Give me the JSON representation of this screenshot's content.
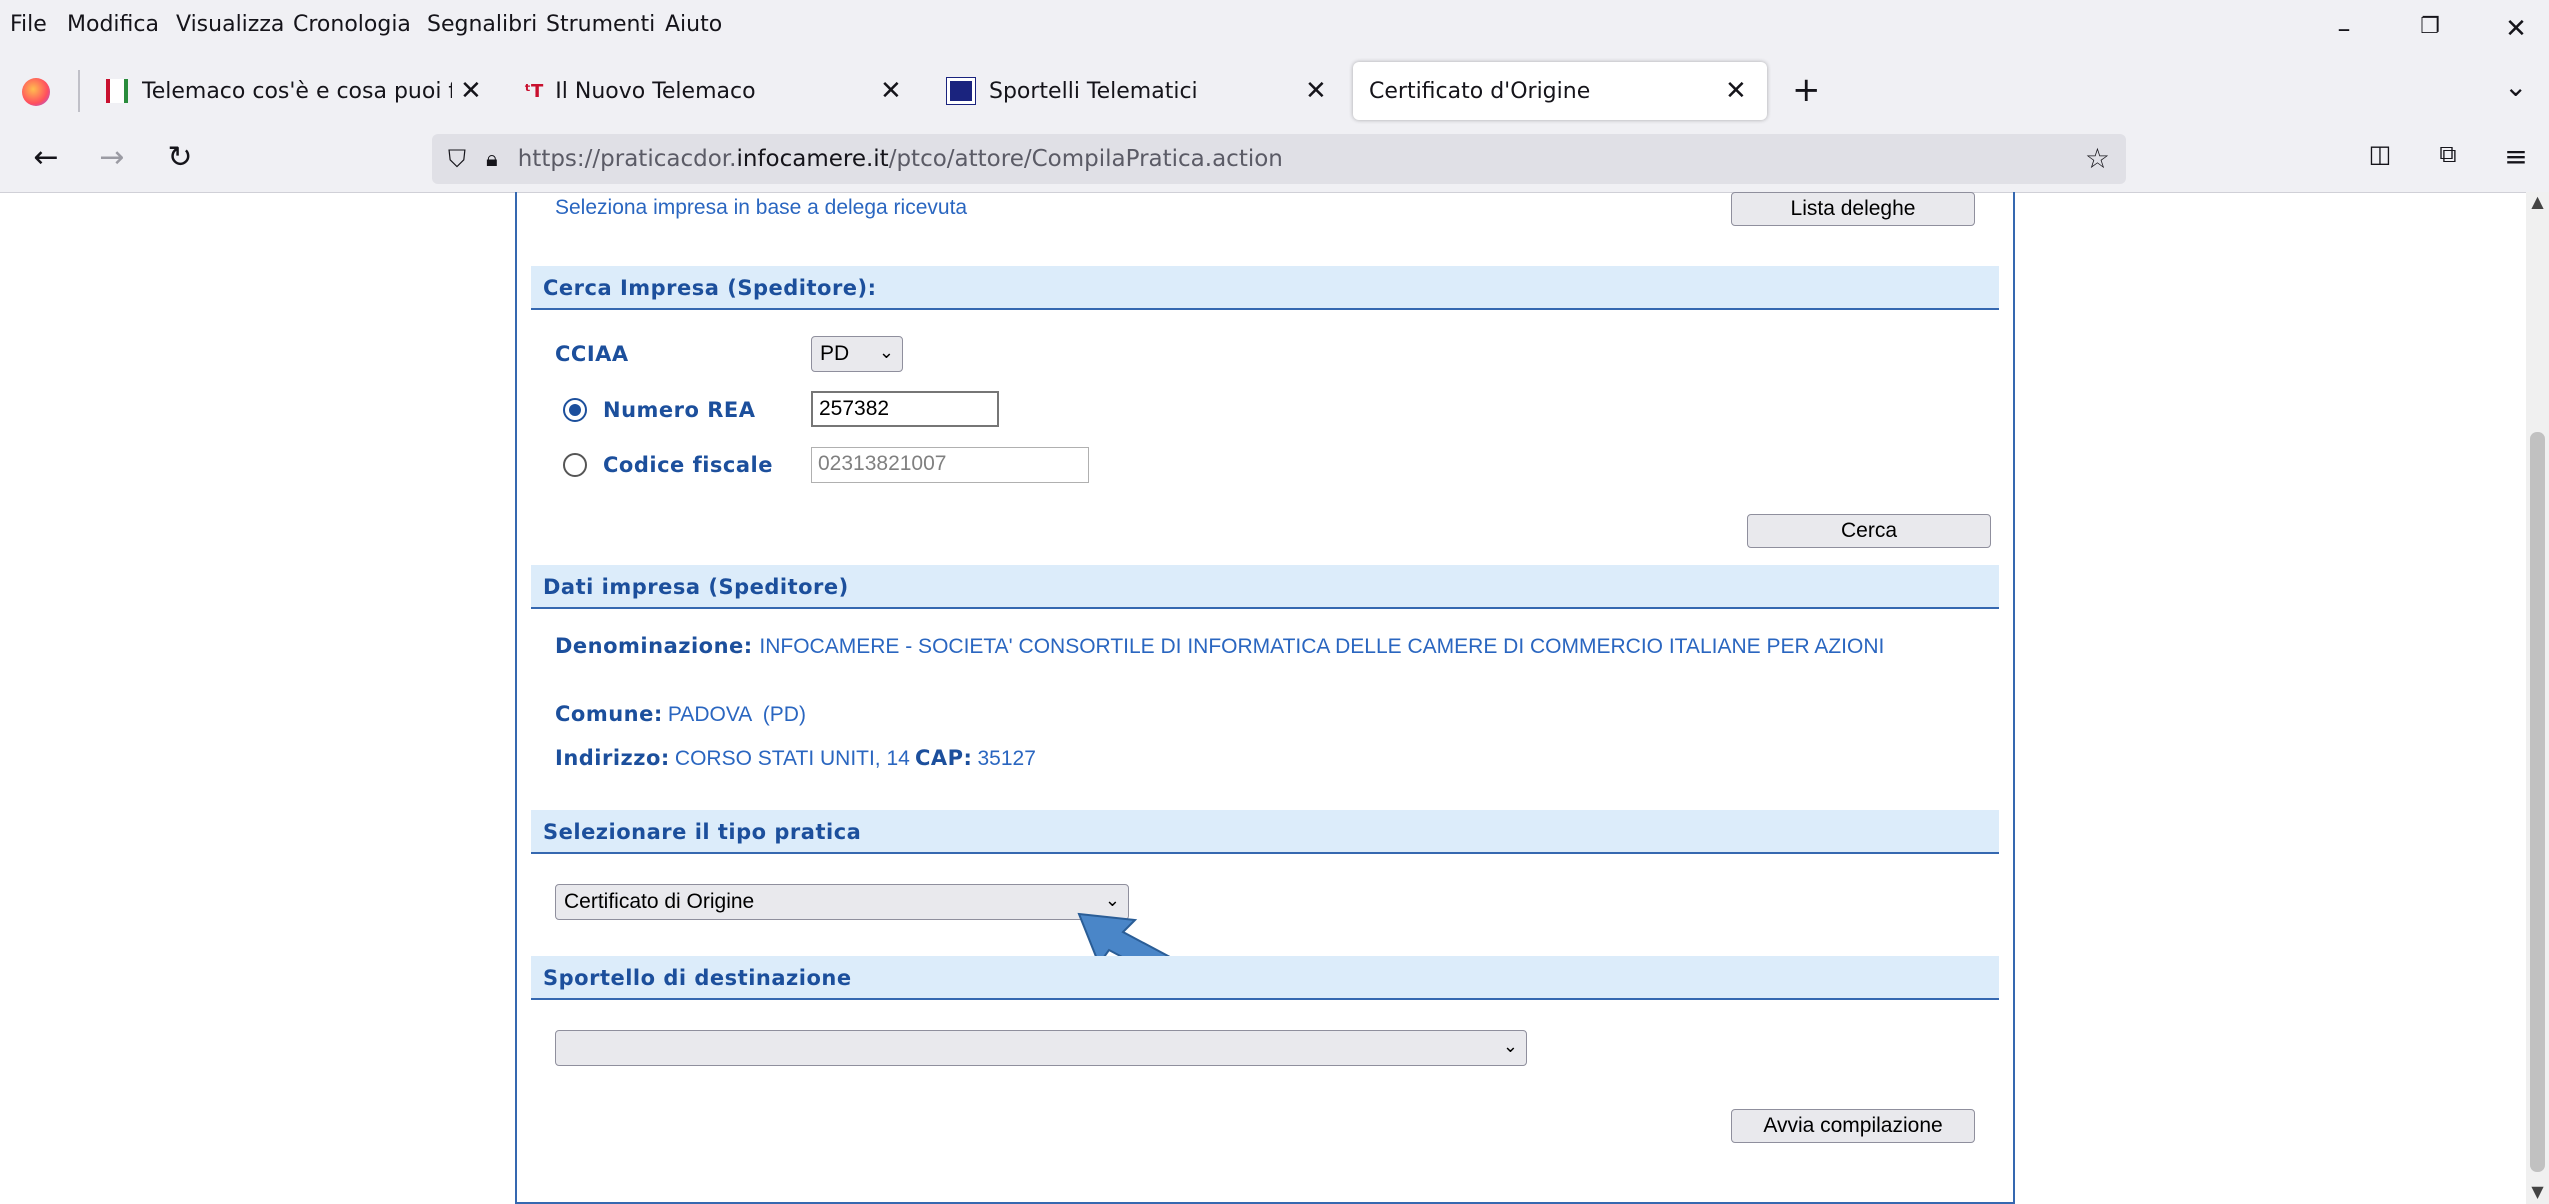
{
  "menubar": {
    "items": [
      "File",
      "Modifica",
      "Visualizza",
      "Cronologia",
      "Segnalibri",
      "Strumenti",
      "Aiuto"
    ],
    "window_controls": {
      "minimize": "–",
      "restore": "❐",
      "close": "✕"
    }
  },
  "tabs": [
    {
      "label": "Telemaco cos'è e cosa puoi fare",
      "icon": "telemaco-icon",
      "active": false
    },
    {
      "label": "Il Nuovo Telemaco",
      "icon": "telemaco-new-icon",
      "active": false
    },
    {
      "label": "Sportelli Telematici",
      "icon": "sportelli-icon",
      "active": false
    },
    {
      "label": "Certificato d'Origine",
      "icon": "",
      "active": true
    }
  ],
  "tab_close": "✕",
  "new_tab": "+",
  "navbar": {
    "url_prefix": "https://praticacdor.",
    "url_host": "infocamere.it",
    "url_path": "/ptco/attore/CompilaPratica.action"
  },
  "form": {
    "delega_text": "Seleziona impresa in base a delega ricevuta",
    "delega_button": "Lista deleghe",
    "cerca_section": "Cerca Impresa (Speditore):",
    "cciaa_label": "CCIAA",
    "cciaa_value": "PD",
    "rea_label": "Numero REA",
    "rea_value": "257382",
    "cf_label": "Codice fiscale",
    "cf_value": "02313821007",
    "cerca_button": "Cerca",
    "dati_section": "Dati impresa (Speditore)",
    "denominazione_label": "Denominazione:",
    "denominazione_value": "INFOCAMERE - SOCIETA' CONSORTILE DI INFORMATICA DELLE CAMERE DI COMMERCIO ITALIANE PER AZIONI",
    "comune_label": "Comune:",
    "comune_value": "PADOVA  (PD)",
    "indirizzo_label": "Indirizzo:",
    "indirizzo_value": "CORSO STATI UNITI, 14",
    "cap_label": "CAP:",
    "cap_value": "35127",
    "tipo_section": "Selezionare il tipo pratica",
    "tipo_value": "Certificato di Origine",
    "sportello_section": "Sportello di destinazione",
    "sportello_value": "",
    "avvia_button": "Avvia compilazione"
  },
  "colors": {
    "accent": "#1c4f9c",
    "section_bg": "#dcecfa",
    "arrow": "#4a86c8"
  }
}
